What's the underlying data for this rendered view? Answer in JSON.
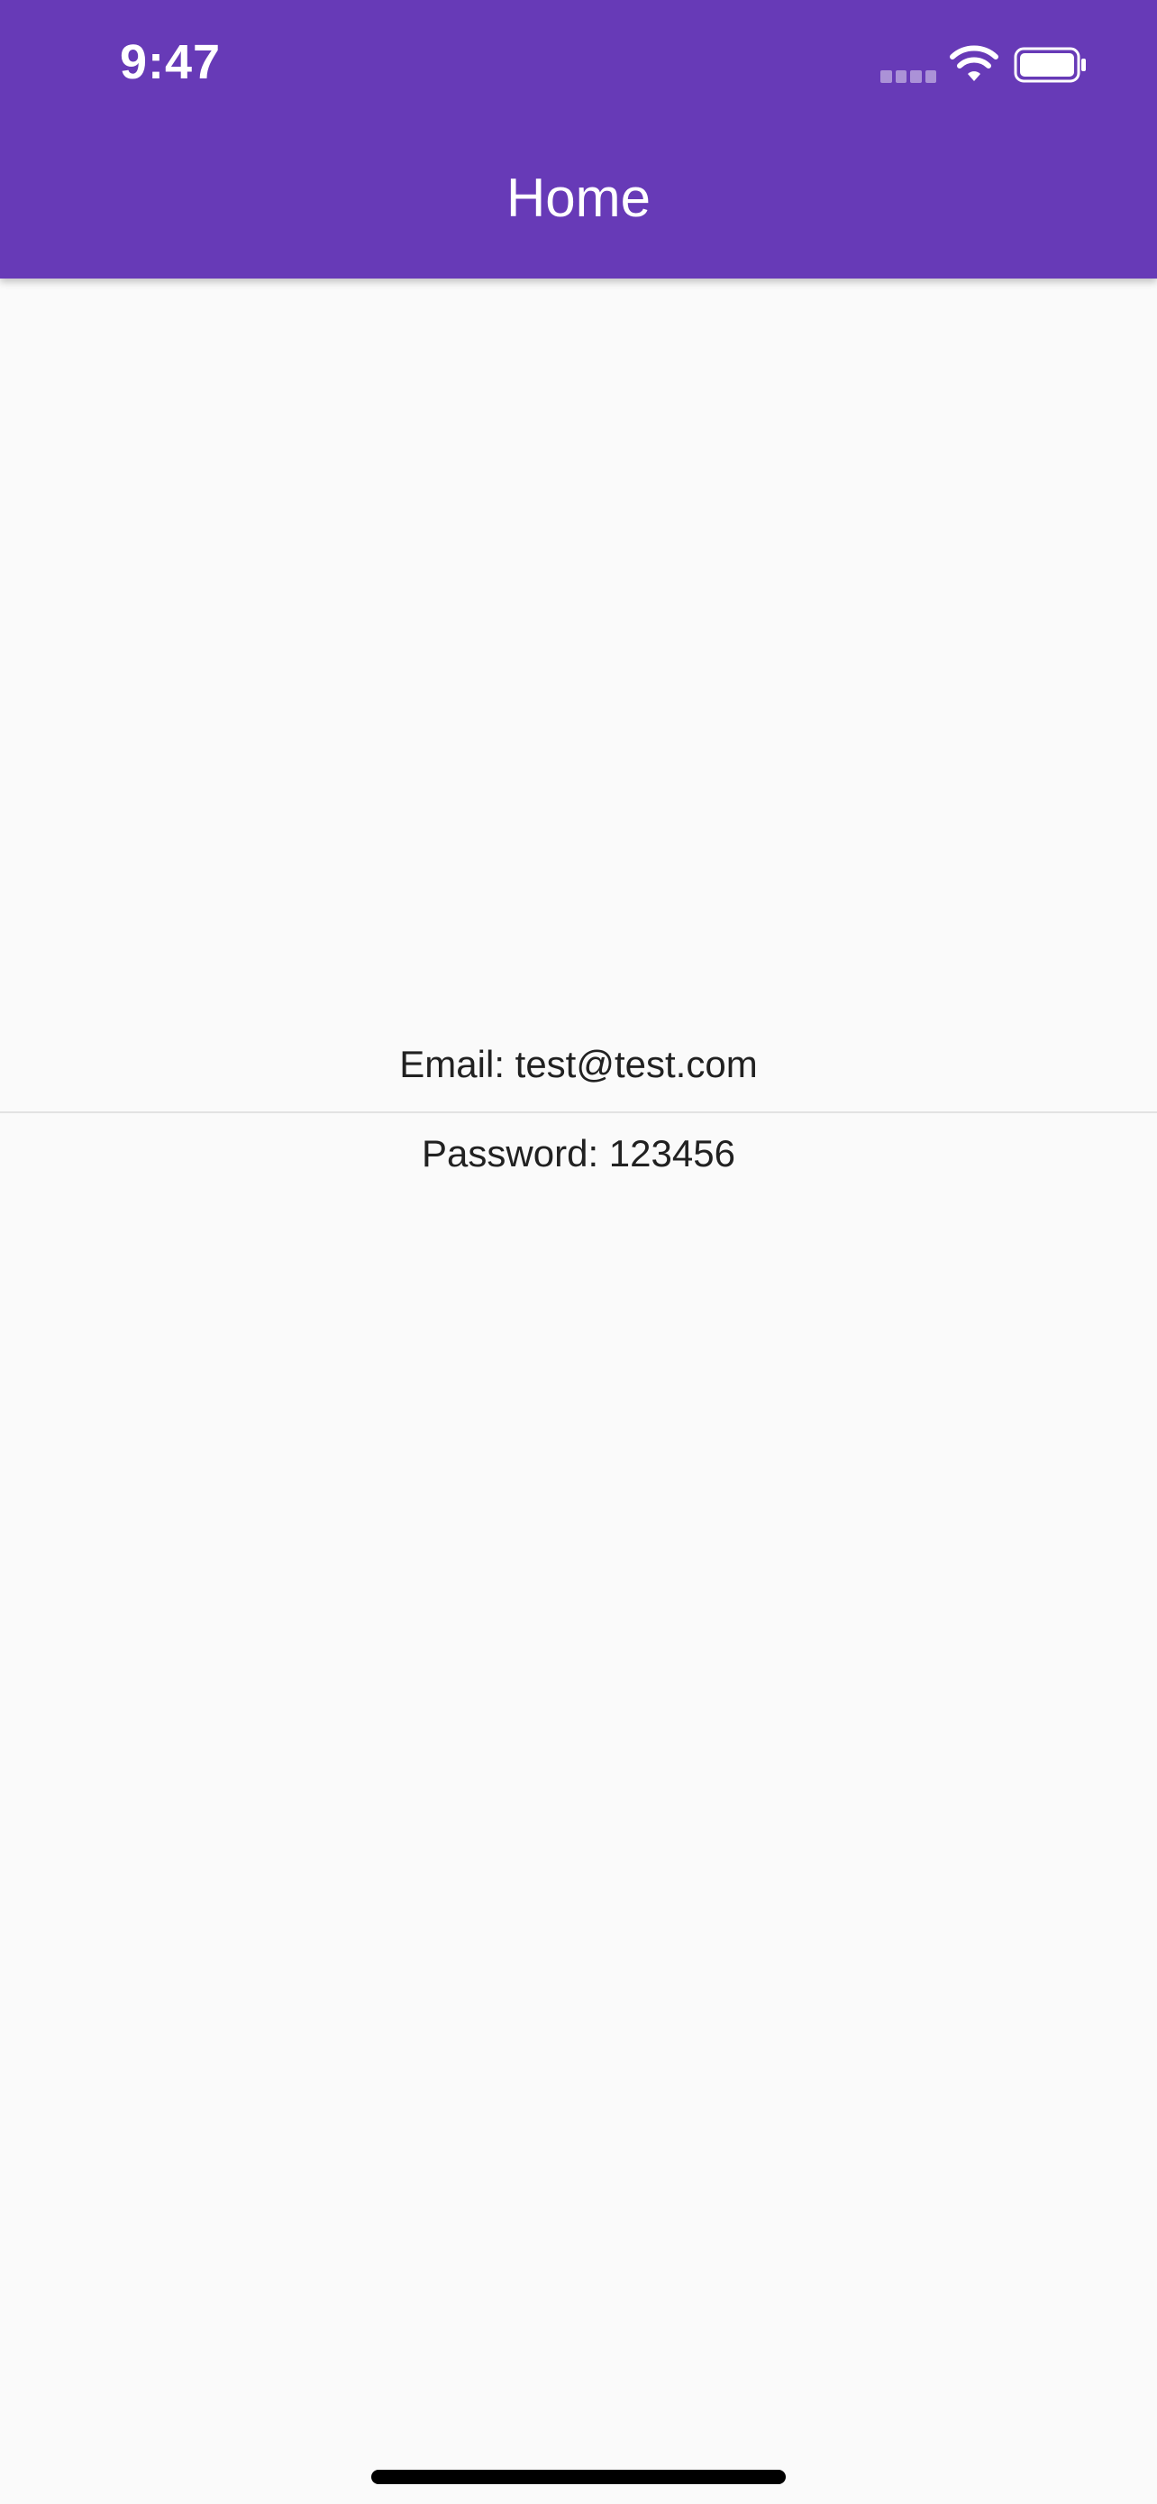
{
  "status_bar": {
    "time": "9:47"
  },
  "app_bar": {
    "title": "Home",
    "color": "#673ab7"
  },
  "content": {
    "email_text": "Email: test@test.com",
    "password_text": "Password: 123456"
  },
  "icons": [
    "signal-icon",
    "wifi-icon",
    "battery-icon"
  ]
}
